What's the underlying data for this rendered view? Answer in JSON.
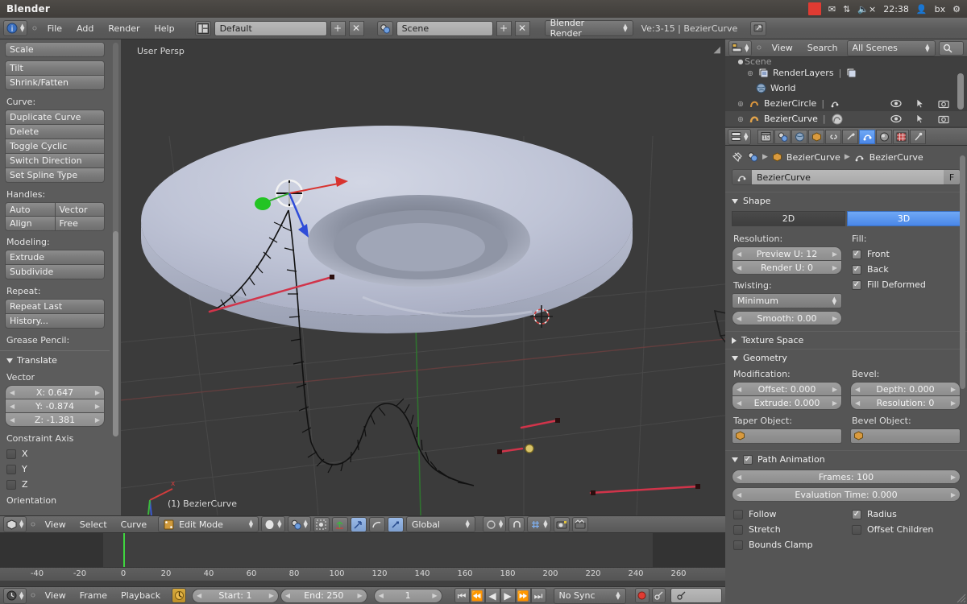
{
  "os": {
    "app_title": "Blender",
    "tray": {
      "clock": "22:38",
      "user": "bx"
    }
  },
  "top_header": {
    "menus": [
      "File",
      "Add",
      "Render",
      "Help"
    ],
    "screen_layout": "Default",
    "scene_name": "Scene",
    "render_engine": "Blender Render",
    "status": "Ve:3-15 | BezierCurve"
  },
  "toolshelf": {
    "transform_buttons": [
      "Scale",
      "Tilt",
      "Shrink/Fatten"
    ],
    "curve_label": "Curve:",
    "curve_buttons": [
      "Duplicate Curve",
      "Delete",
      "Toggle Cyclic",
      "Switch Direction",
      "Set Spline Type"
    ],
    "handles_label": "Handles:",
    "handles_buttons": [
      "Auto",
      "Vector",
      "Align",
      "Free"
    ],
    "modeling_label": "Modeling:",
    "modeling_buttons": [
      "Extrude",
      "Subdivide"
    ],
    "repeat_label": "Repeat:",
    "repeat_buttons": [
      "Repeat Last",
      "History..."
    ],
    "grease_pencil_label": "Grease Pencil:",
    "operator_panel": {
      "title": "Translate",
      "vector_label": "Vector",
      "vector": [
        "X: 0.647",
        "Y: -0.874",
        "Z: -1.381"
      ],
      "constraint_label": "Constraint Axis",
      "constraint_axes": [
        {
          "label": "X",
          "checked": false
        },
        {
          "label": "Y",
          "checked": false
        },
        {
          "label": "Z",
          "checked": false
        }
      ],
      "orientation_label": "Orientation"
    }
  },
  "viewport": {
    "view_name": "User Persp",
    "object_info": "(1) BezierCurve",
    "header": {
      "mode": "Edit Mode",
      "menus": [
        "View",
        "Select",
        "Curve"
      ],
      "transform_orientation": "Global"
    }
  },
  "timeline": {
    "ticks": [
      "-40",
      "-20",
      "0",
      "20",
      "40",
      "60",
      "80",
      "100",
      "120",
      "140",
      "160",
      "180",
      "200",
      "220",
      "240",
      "260"
    ],
    "menus": [
      "View",
      "Frame",
      "Playback"
    ],
    "start": "Start: 1",
    "end": "End: 250",
    "current_frame": "1",
    "sync_mode": "No Sync"
  },
  "outliner": {
    "menus": [
      "View",
      "Search"
    ],
    "display_mode": "All Scenes",
    "rows": [
      {
        "name": "RenderLayers",
        "icon": "renderlayers-icon",
        "indent": 1,
        "expandable": true,
        "selected": false,
        "has_visibility": false
      },
      {
        "name": "World",
        "icon": "world-icon",
        "indent": 2,
        "expandable": false,
        "selected": false,
        "has_visibility": false
      },
      {
        "name": "BezierCircle",
        "icon": "curve-icon",
        "indent": 1,
        "expandable": true,
        "selected": false,
        "has_visibility": true
      },
      {
        "name": "BezierCurve",
        "icon": "curve-icon",
        "indent": 1,
        "expandable": true,
        "selected": true,
        "has_visibility": true
      }
    ]
  },
  "properties": {
    "breadcrumb": [
      "BezierCurve",
      "BezierCurve"
    ],
    "datablock_name": "BezierCurve",
    "datablock_fake_user": "F",
    "shape": {
      "title": "Shape",
      "dimension_options": [
        "2D",
        "3D"
      ],
      "dimension_active": "3D",
      "resolution_label": "Resolution:",
      "preview_u": "Preview U: 12",
      "render_u": "Render U: 0",
      "twisting_label": "Twisting:",
      "twisting_method": "Minimum",
      "smooth": "Smooth: 0.00",
      "fill_label": "Fill:",
      "fill_options": [
        {
          "label": "Front",
          "checked": true
        },
        {
          "label": "Back",
          "checked": true
        },
        {
          "label": "Fill Deformed",
          "checked": true
        }
      ]
    },
    "texture_space": {
      "title": "Texture Space",
      "expanded": false
    },
    "geometry": {
      "title": "Geometry",
      "modification_label": "Modification:",
      "offset": "Offset: 0.000",
      "extrude": "Extrude: 0.000",
      "bevel_label": "Bevel:",
      "depth": "Depth: 0.000",
      "resolution": "Resolution: 0",
      "taper_object_label": "Taper Object:",
      "taper_object_value": "",
      "bevel_object_label": "Bevel Object:",
      "bevel_object_value": ""
    },
    "path_animation": {
      "title": "Path Animation",
      "enabled": true,
      "frames": "Frames: 100",
      "evaluation_time": "Evaluation Time: 0.000",
      "options": [
        {
          "label": "Follow",
          "checked": false
        },
        {
          "label": "Radius",
          "checked": true
        },
        {
          "label": "Stretch",
          "checked": false
        },
        {
          "label": "Offset Children",
          "checked": false
        },
        {
          "label": "Bounds Clamp",
          "checked": false
        }
      ]
    }
  },
  "colors": {
    "accent_blue": "#4a87e8",
    "curve_orange": "#e09a4a",
    "axis_x": "#d13c3c",
    "axis_y": "#3cb83c",
    "axis_z": "#3c5ad1",
    "record_red": "#e03b32"
  }
}
